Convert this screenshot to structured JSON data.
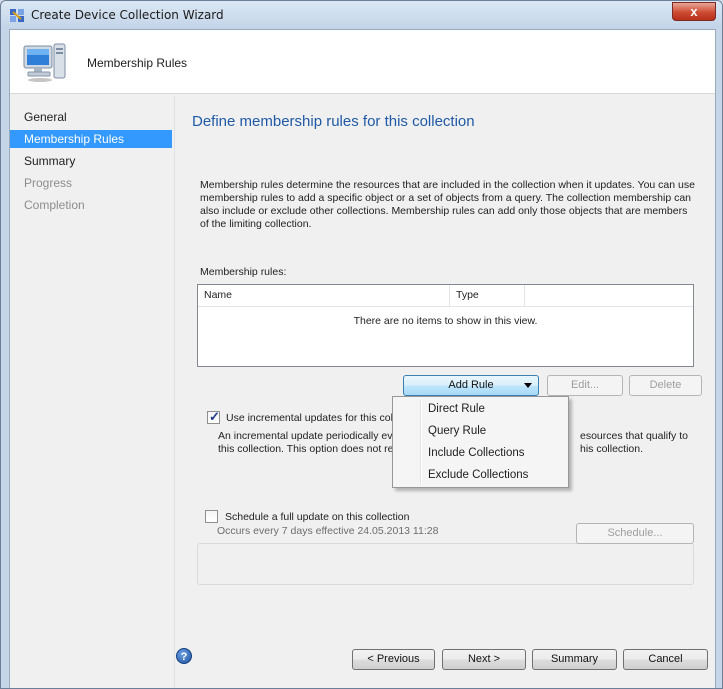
{
  "window": {
    "title": "Create Device Collection Wizard",
    "close_glyph": "x"
  },
  "header": {
    "title": "Membership Rules",
    "icon": "computer-icon"
  },
  "nav": {
    "items": [
      {
        "label": "General",
        "state": "normal"
      },
      {
        "label": "Membership Rules",
        "state": "active"
      },
      {
        "label": "Summary",
        "state": "normal"
      },
      {
        "label": "Progress",
        "state": "disabled"
      },
      {
        "label": "Completion",
        "state": "disabled"
      }
    ]
  },
  "main": {
    "title": "Define membership rules for this collection",
    "description": "Membership rules determine the resources that are included in the collection when it updates. You can use membership rules to add a specific object or a set of objects from a query. The collection membership can also include or exclude other collections. Membership rules can add only those objects that are members of the limiting collection.",
    "rules_label": "Membership rules:",
    "columns": [
      "Name",
      "Type"
    ],
    "empty_text": "There are no items to show in this view.",
    "buttons": {
      "add_rule": "Add Rule",
      "edit": "Edit...",
      "delete": "Delete"
    },
    "incremental": {
      "checked": true,
      "label": "Use incremental updates for this colle",
      "description_left": "An incremental update periodically eva",
      "description_right": "esources that qualify to",
      "description_line2_left": "this collection. This option does not re",
      "description_line2_right": "his collection."
    },
    "schedule": {
      "checked": false,
      "label": "Schedule a full update on this collection",
      "occurs": "Occurs every 7 days effective 24.05.2013 11:28",
      "button": "Schedule..."
    }
  },
  "dropdown": {
    "items": [
      "Direct Rule",
      "Query Rule",
      "Include Collections",
      "Exclude Collections"
    ]
  },
  "footer": {
    "help_glyph": "?",
    "previous": "< Previous",
    "next": "Next >",
    "summary": "Summary",
    "cancel": "Cancel"
  },
  "colors": {
    "accent": "#3399ff",
    "title_blue": "#1f5aa6",
    "close_red": "#c7432b"
  }
}
